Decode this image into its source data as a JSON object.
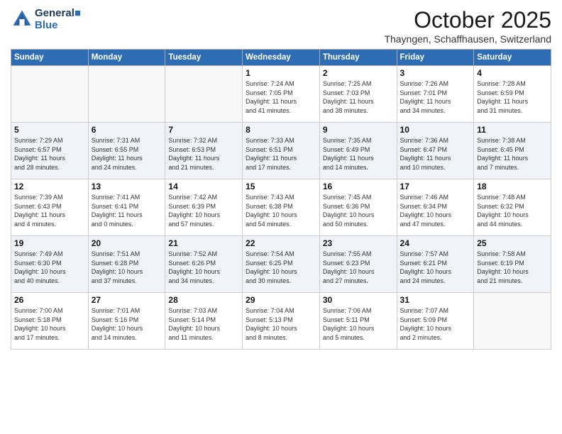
{
  "header": {
    "logo_line1": "General",
    "logo_line2": "Blue",
    "month_title": "October 2025",
    "location": "Thayngen, Schaffhausen, Switzerland"
  },
  "days_of_week": [
    "Sunday",
    "Monday",
    "Tuesday",
    "Wednesday",
    "Thursday",
    "Friday",
    "Saturday"
  ],
  "weeks": [
    [
      {
        "day": "",
        "info": ""
      },
      {
        "day": "",
        "info": ""
      },
      {
        "day": "",
        "info": ""
      },
      {
        "day": "1",
        "info": "Sunrise: 7:24 AM\nSunset: 7:05 PM\nDaylight: 11 hours\nand 41 minutes."
      },
      {
        "day": "2",
        "info": "Sunrise: 7:25 AM\nSunset: 7:03 PM\nDaylight: 11 hours\nand 38 minutes."
      },
      {
        "day": "3",
        "info": "Sunrise: 7:26 AM\nSunset: 7:01 PM\nDaylight: 11 hours\nand 34 minutes."
      },
      {
        "day": "4",
        "info": "Sunrise: 7:28 AM\nSunset: 6:59 PM\nDaylight: 11 hours\nand 31 minutes."
      }
    ],
    [
      {
        "day": "5",
        "info": "Sunrise: 7:29 AM\nSunset: 6:57 PM\nDaylight: 11 hours\nand 28 minutes."
      },
      {
        "day": "6",
        "info": "Sunrise: 7:31 AM\nSunset: 6:55 PM\nDaylight: 11 hours\nand 24 minutes."
      },
      {
        "day": "7",
        "info": "Sunrise: 7:32 AM\nSunset: 6:53 PM\nDaylight: 11 hours\nand 21 minutes."
      },
      {
        "day": "8",
        "info": "Sunrise: 7:33 AM\nSunset: 6:51 PM\nDaylight: 11 hours\nand 17 minutes."
      },
      {
        "day": "9",
        "info": "Sunrise: 7:35 AM\nSunset: 6:49 PM\nDaylight: 11 hours\nand 14 minutes."
      },
      {
        "day": "10",
        "info": "Sunrise: 7:36 AM\nSunset: 6:47 PM\nDaylight: 11 hours\nand 10 minutes."
      },
      {
        "day": "11",
        "info": "Sunrise: 7:38 AM\nSunset: 6:45 PM\nDaylight: 11 hours\nand 7 minutes."
      }
    ],
    [
      {
        "day": "12",
        "info": "Sunrise: 7:39 AM\nSunset: 6:43 PM\nDaylight: 11 hours\nand 4 minutes."
      },
      {
        "day": "13",
        "info": "Sunrise: 7:41 AM\nSunset: 6:41 PM\nDaylight: 11 hours\nand 0 minutes."
      },
      {
        "day": "14",
        "info": "Sunrise: 7:42 AM\nSunset: 6:39 PM\nDaylight: 10 hours\nand 57 minutes."
      },
      {
        "day": "15",
        "info": "Sunrise: 7:43 AM\nSunset: 6:38 PM\nDaylight: 10 hours\nand 54 minutes."
      },
      {
        "day": "16",
        "info": "Sunrise: 7:45 AM\nSunset: 6:36 PM\nDaylight: 10 hours\nand 50 minutes."
      },
      {
        "day": "17",
        "info": "Sunrise: 7:46 AM\nSunset: 6:34 PM\nDaylight: 10 hours\nand 47 minutes."
      },
      {
        "day": "18",
        "info": "Sunrise: 7:48 AM\nSunset: 6:32 PM\nDaylight: 10 hours\nand 44 minutes."
      }
    ],
    [
      {
        "day": "19",
        "info": "Sunrise: 7:49 AM\nSunset: 6:30 PM\nDaylight: 10 hours\nand 40 minutes."
      },
      {
        "day": "20",
        "info": "Sunrise: 7:51 AM\nSunset: 6:28 PM\nDaylight: 10 hours\nand 37 minutes."
      },
      {
        "day": "21",
        "info": "Sunrise: 7:52 AM\nSunset: 6:26 PM\nDaylight: 10 hours\nand 34 minutes."
      },
      {
        "day": "22",
        "info": "Sunrise: 7:54 AM\nSunset: 6:25 PM\nDaylight: 10 hours\nand 30 minutes."
      },
      {
        "day": "23",
        "info": "Sunrise: 7:55 AM\nSunset: 6:23 PM\nDaylight: 10 hours\nand 27 minutes."
      },
      {
        "day": "24",
        "info": "Sunrise: 7:57 AM\nSunset: 6:21 PM\nDaylight: 10 hours\nand 24 minutes."
      },
      {
        "day": "25",
        "info": "Sunrise: 7:58 AM\nSunset: 6:19 PM\nDaylight: 10 hours\nand 21 minutes."
      }
    ],
    [
      {
        "day": "26",
        "info": "Sunrise: 7:00 AM\nSunset: 5:18 PM\nDaylight: 10 hours\nand 17 minutes."
      },
      {
        "day": "27",
        "info": "Sunrise: 7:01 AM\nSunset: 5:16 PM\nDaylight: 10 hours\nand 14 minutes."
      },
      {
        "day": "28",
        "info": "Sunrise: 7:03 AM\nSunset: 5:14 PM\nDaylight: 10 hours\nand 11 minutes."
      },
      {
        "day": "29",
        "info": "Sunrise: 7:04 AM\nSunset: 5:13 PM\nDaylight: 10 hours\nand 8 minutes."
      },
      {
        "day": "30",
        "info": "Sunrise: 7:06 AM\nSunset: 5:11 PM\nDaylight: 10 hours\nand 5 minutes."
      },
      {
        "day": "31",
        "info": "Sunrise: 7:07 AM\nSunset: 5:09 PM\nDaylight: 10 hours\nand 2 minutes."
      },
      {
        "day": "",
        "info": ""
      }
    ]
  ]
}
